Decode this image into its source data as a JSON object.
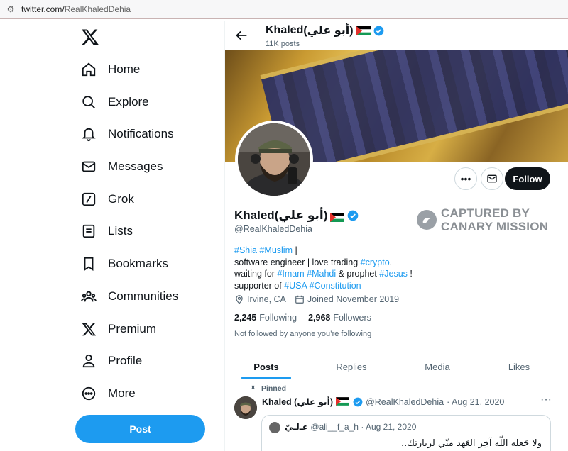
{
  "browser": {
    "url_domain": "twitter.com/",
    "url_path": "RealKhaledDehia"
  },
  "nav": [
    {
      "label": "Home",
      "icon": "home-icon"
    },
    {
      "label": "Explore",
      "icon": "search-icon"
    },
    {
      "label": "Notifications",
      "icon": "bell-icon"
    },
    {
      "label": "Messages",
      "icon": "envelope-icon"
    },
    {
      "label": "Grok",
      "icon": "grok-icon"
    },
    {
      "label": "Lists",
      "icon": "list-icon"
    },
    {
      "label": "Bookmarks",
      "icon": "bookmark-icon"
    },
    {
      "label": "Communities",
      "icon": "people-icon"
    },
    {
      "label": "Premium",
      "icon": "x-logo-icon"
    },
    {
      "label": "Profile",
      "icon": "person-icon"
    },
    {
      "label": "More",
      "icon": "more-circle-icon"
    }
  ],
  "post_button": "Post",
  "header": {
    "name_latin": "Khaled ",
    "name_arabic": "(أبو علي)",
    "posts_count": "11K posts"
  },
  "actions": {
    "follow_label": "Follow"
  },
  "profile": {
    "name_latin": "Khaled ",
    "name_arabic": "(أبو علي)",
    "handle": "@RealKhaledDehia",
    "bio": {
      "l1_t1": "#Shia",
      "l1_t2": "#Muslim",
      "l1_tail": " |",
      "l2_pre": "software engineer | love trading ",
      "l2_t1": "#crypto",
      "l2_tail": ".",
      "l3_pre": "waiting for ",
      "l3_t1": "#Imam",
      "l3_t2": "#Mahdi",
      "l3_mid": " & prophet ",
      "l3_t3": "#Jesus",
      "l3_tail": " !",
      "l4_pre": "supporter of ",
      "l4_t1": "#USA",
      "l4_t2": "#Constitution"
    },
    "location": "Irvine, CA",
    "joined": "Joined November 2019",
    "following_count": "2,245",
    "following_label": "Following",
    "followers_count": "2,968",
    "followers_label": "Followers",
    "not_followed_note": "Not followed by anyone you’re following"
  },
  "watermark": {
    "line1": "CAPTURED BY",
    "line2": "CANARY MISSION"
  },
  "tabs": [
    {
      "label": "Posts",
      "active": true
    },
    {
      "label": "Replies",
      "active": false
    },
    {
      "label": "Media",
      "active": false
    },
    {
      "label": "Likes",
      "active": false
    }
  ],
  "pinned_tweet": {
    "pinned_label": "Pinned",
    "name_latin": "Khaled ",
    "name_arabic": "(أبو علي)",
    "handle": "@RealKhaledDehia",
    "date": "· Aug 21, 2020",
    "quote": {
      "name": "ﻋـﻟـيّ",
      "handle": "@ali__f_a_h",
      "date": "· Aug 21, 2020",
      "text": "ولا جَعله اللّه آخِر العَهد منّي لزيارتك.."
    }
  },
  "colors": {
    "accent": "#1d9bf0",
    "text": "#0f1419",
    "muted": "#536471",
    "follow_bg": "#0f1419"
  }
}
